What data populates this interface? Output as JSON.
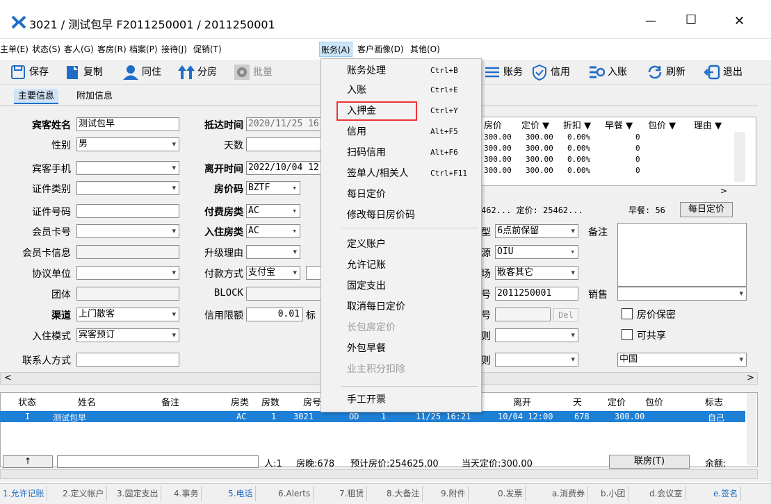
{
  "window": {
    "title": "3021 / 测试包早 F2011250001 / 2011250001",
    "minimize": "—",
    "maximize": "☐",
    "close": "✕"
  },
  "menu": [
    "主单(E)",
    "状态(S)",
    "客人(G)",
    "客房(R)",
    "档案(P)",
    "接待(J)",
    "促销(T)",
    "账务(A)",
    "客户画像(D)",
    "其他(O)"
  ],
  "toolbar": {
    "save": "保存",
    "copy": "复制",
    "cohabit": "同住",
    "split": "分房",
    "batch": "批量",
    "account": "账务",
    "credit": "信用",
    "post": "入账",
    "refresh": "刷新",
    "exit": "退出"
  },
  "tabs": {
    "main": "主要信息",
    "extra": "附加信息"
  },
  "form": {
    "guest_name_label": "宾客姓名",
    "guest_name": "测试包早",
    "gender_label": "性别",
    "gender": "男",
    "phone_label": "宾客手机",
    "phone": "",
    "id_type_label": "证件类别",
    "id_type": "",
    "id_no_label": "证件号码",
    "id_no": "",
    "member_no_label": "会员卡号",
    "member_no": "",
    "member_info_label": "会员卡信息",
    "member_info": "",
    "agreement_label": "协议单位",
    "agreement": "",
    "group_label": "团体",
    "group": "",
    "channel_label": "渠道",
    "channel": "上门散客",
    "mode_label": "入住模式",
    "mode": "宾客预订",
    "contact_label": "联系人方式",
    "contact": "",
    "arrive_label": "抵达时间",
    "arrive": "2020/11/25 16",
    "days_label": "天数",
    "days": "",
    "depart_label": "离开时间",
    "depart": "2022/10/04 12",
    "rate_code_label": "房价码",
    "rate_code": "BZTF",
    "pay_room_label": "付费房类",
    "pay_room": "AC",
    "stay_room_label": "入住房类",
    "stay_room": "AC",
    "upgrade_label": "升级理由",
    "upgrade": "",
    "pay_method_label": "付款方式",
    "pay_method": "支付宝",
    "block_label": "BLOCK",
    "block": "",
    "credit_label": "信用限额",
    "credit": "0.01",
    "credit_suffix": "标"
  },
  "rate_grid": {
    "headers": [
      "房价",
      "定价 ▼",
      "折扣 ▼",
      "早餐 ▼",
      "包价 ▼",
      "理由 ▼"
    ],
    "rows": [
      [
        "300.00",
        "300.00",
        "0.00%",
        "0"
      ],
      [
        "300.00",
        "300.00",
        "0.00%",
        "0"
      ],
      [
        "300.00",
        "300.00",
        "0.00%",
        "0"
      ],
      [
        "300.00",
        "300.00",
        "0.00%",
        "0"
      ]
    ]
  },
  "summary": {
    "text": "462... 定价: 25462...",
    "breakfast": "早餐: 56",
    "daily_btn": "每日定价"
  },
  "right_form": {
    "type_label": "型",
    "type": "6点前保留",
    "remark_label": "备注",
    "source_label": "源",
    "source": "OIU",
    "market_label": "场",
    "market": "散客其它",
    "no_label": "号",
    "no": "2011250001",
    "sales_label": "销售",
    "sales": "",
    "no2_label": "号",
    "del": "Del",
    "rule1_label": "则",
    "rule2_label": "则",
    "secret": "房价保密",
    "share": "可共享",
    "country": "中国"
  },
  "dropdown": [
    {
      "label": "账务处理",
      "sc": "Ctrl+B"
    },
    {
      "label": "入账",
      "sc": "Ctrl+E"
    },
    {
      "label": "入押金",
      "sc": "Ctrl+Y"
    },
    {
      "label": "信用",
      "sc": "Alt+F5"
    },
    {
      "label": "扫码信用",
      "sc": "Alt+F6"
    },
    {
      "label": "签单人/相关人",
      "sc": "Ctrl+F11"
    },
    {
      "label": "每日定价",
      "sc": ""
    },
    {
      "label": "修改每日房价码",
      "sc": ""
    },
    {
      "label": "定义账户",
      "sc": ""
    },
    {
      "label": "允许记账",
      "sc": ""
    },
    {
      "label": "固定支出",
      "sc": ""
    },
    {
      "label": "取消每日定价",
      "sc": ""
    },
    {
      "label": "长包房定价",
      "sc": ""
    },
    {
      "label": "外包早餐",
      "sc": ""
    },
    {
      "label": "业主积分扣除",
      "sc": ""
    },
    {
      "label": "手工开票",
      "sc": ""
    }
  ],
  "list": {
    "headers": [
      "状态",
      "姓名",
      "备注",
      "房类",
      "房数",
      "房号",
      "离开",
      "天",
      "定价",
      "包价",
      "标志"
    ],
    "row": {
      "status": "I",
      "name": "测试包早",
      "room_type": "AC",
      "rooms": "1",
      "room_no": "3021",
      "od": "OD",
      "n": "1",
      "arrive": "11/25 16:21",
      "depart": "10/04 12:00",
      "days": "678",
      "rate": "300.00",
      "flag": "自己"
    }
  },
  "footer": {
    "up": "↑",
    "persons": "人:1",
    "nights": "房晚:678",
    "est": "预计房价:254625.00",
    "today": "当天定价:300.00",
    "link": "联房(T)",
    "balance": "余额:"
  },
  "status_tabs": [
    "1.允许记账",
    "2.定义帐户",
    "3.固定支出",
    "4.事务",
    "5.电话",
    "6.Alerts",
    "7.租赁",
    "8.大备注",
    "9.附件",
    "0.发票",
    "a.消费券",
    "b.小团",
    "d.会议室",
    "e.签名"
  ],
  "colors": {
    "accent": "#1e6ec8",
    "highlight": "#e33",
    "selected_row": "#1e7fd6"
  }
}
